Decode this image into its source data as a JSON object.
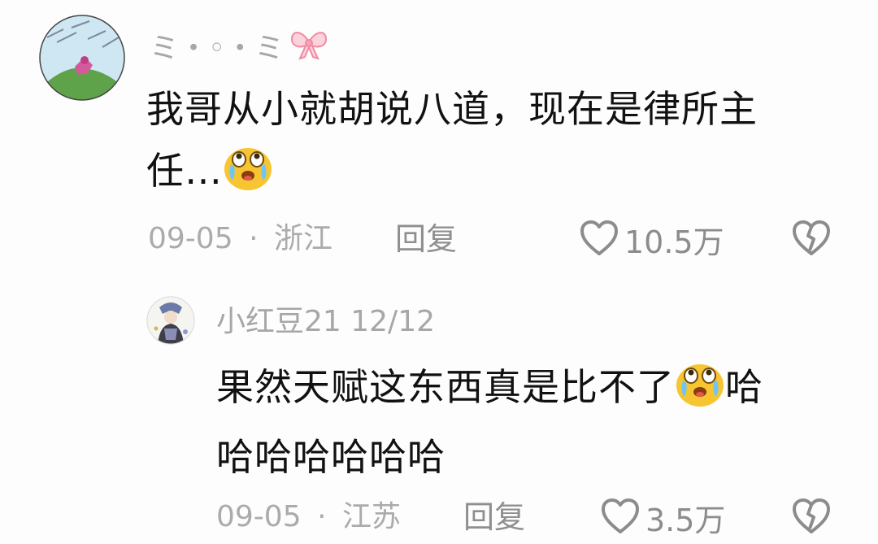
{
  "comments": [
    {
      "username": "ミ・◦・ミ",
      "username_icon": "bow-icon",
      "text_line1": "我哥从小就胡说八道，现在是律所主",
      "text_line2": "任…",
      "emoji": "crying-laughing-emoji",
      "date": "09-05",
      "separator": "·",
      "location": "浙江",
      "reply_label": "回复",
      "like_icon": "heart-outline-icon",
      "likes": "10.5万",
      "dislike_icon": "broken-heart-icon"
    },
    {
      "username": "小红豆21 12/12",
      "text_line1": "果然天赋这东西真是比不了",
      "text_line1_tail": "哈",
      "text_line2": "哈哈哈哈哈哈",
      "emoji": "crying-laughing-emoji",
      "date": "09-05",
      "separator": "·",
      "location": "江苏",
      "reply_label": "回复",
      "like_icon": "heart-outline-icon",
      "likes": "3.5万",
      "dislike_icon": "broken-heart-icon"
    }
  ],
  "colors": {
    "background": "#fdfdfd",
    "text_primary": "#111111",
    "text_secondary": "#a7a7a7",
    "bow_pink": "#f4a6b8",
    "emoji_yellow": "#f7c531"
  }
}
